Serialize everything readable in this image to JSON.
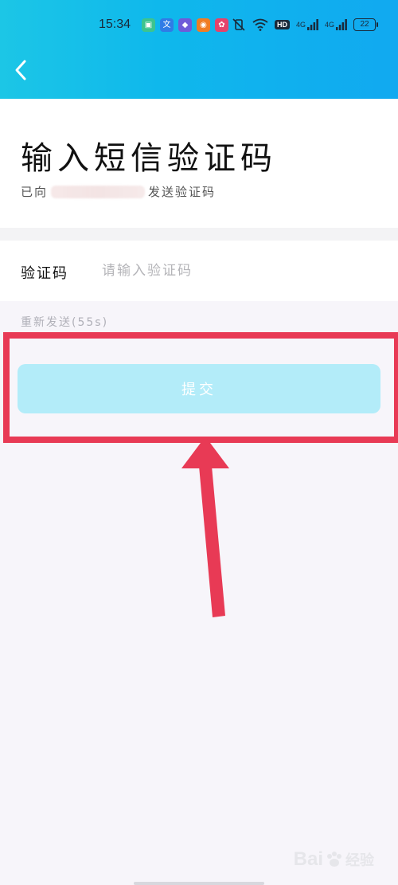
{
  "status_bar": {
    "time": "15:34",
    "hd_label": "HD",
    "network_1": "4G",
    "network_2": "4G",
    "battery": "22"
  },
  "header": {
    "back_icon": "chevron-left-icon"
  },
  "title_section": {
    "title": "输入短信验证码",
    "subtitle_prefix": "已向",
    "subtitle_suffix": "发送验证码"
  },
  "form": {
    "code_label": "验证码",
    "code_placeholder": "请输入验证码",
    "code_value": "",
    "resend_label": "重新发送(55s)"
  },
  "submit": {
    "label": "提交"
  },
  "watermark": {
    "text": "Bai",
    "suffix": "经验"
  },
  "colors": {
    "header_gradient_start": "#1cc6e6",
    "header_gradient_end": "#11a9f0",
    "submit_disabled": "#b3ecf9",
    "annotation_red": "#e83a55"
  }
}
